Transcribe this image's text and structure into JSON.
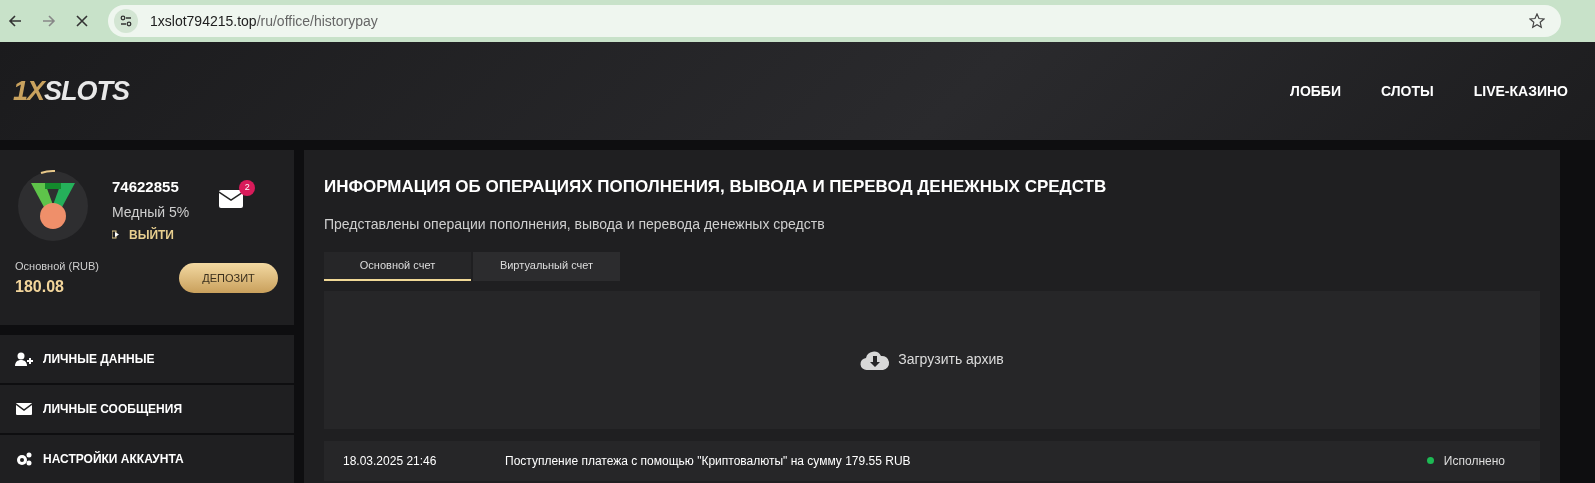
{
  "browser": {
    "url_host": "1xslot794215.top",
    "url_path": "/ru/office/historypay"
  },
  "header": {
    "logo": {
      "accent": "1X",
      "rest": "SLOTS"
    },
    "nav": [
      {
        "label": "ЛОББИ"
      },
      {
        "label": "СЛОТЫ"
      },
      {
        "label": "LIVE-КАЗИНО"
      }
    ]
  },
  "profile": {
    "user_id": "74622855",
    "level": "Медный 5%",
    "logout": "ВЫЙТИ",
    "messages_badge": "2",
    "balance_label": "Основной (RUB)",
    "balance": "180.08",
    "deposit": "ДЕПОЗИТ"
  },
  "sidebar": {
    "items": [
      {
        "label": "ЛИЧНЫЕ ДАННЫЕ",
        "kind": "user"
      },
      {
        "label": "ЛИЧНЫЕ СООБЩЕНИЯ",
        "kind": "mail"
      },
      {
        "label": "НАСТРОЙКИ АККАУНТА",
        "kind": "gears"
      }
    ]
  },
  "main": {
    "title": "ИНФОРМАЦИЯ ОБ ОПЕРАЦИЯХ ПОПОЛНЕНИЯ, ВЫВОДА И ПЕРЕВОД ДЕНЕЖНЫХ СРЕДСТВ",
    "subtitle": "Представлены операции пополнения, вывода и перевода денежных средств",
    "tabs": [
      {
        "label": "Основной счет",
        "selected": true
      },
      {
        "label": "Виртуальный счет",
        "selected": false
      }
    ],
    "archive": "Загрузить архив",
    "rows": [
      {
        "date": "18.03.2025 21:46",
        "description": "Поступление платежа с помощью \"Криптовалюты\" на сумму 179.55 RUB",
        "status": "Исполнено",
        "color": "#1db954"
      }
    ]
  }
}
